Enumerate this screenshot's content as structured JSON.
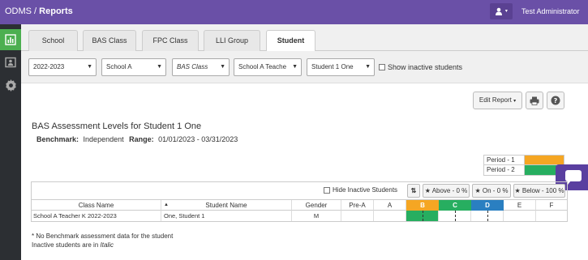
{
  "header": {
    "app_name": "ODMS",
    "separator": " / ",
    "page": "Reports",
    "user_icon": "user-icon",
    "user_name": "Test Administrator"
  },
  "sidebar": {
    "items": [
      {
        "icon": "bar-chart-icon",
        "active": true
      },
      {
        "icon": "id-card-icon",
        "active": false
      },
      {
        "icon": "gear-icon",
        "active": false
      }
    ]
  },
  "tabs": [
    {
      "label": "School",
      "active": false
    },
    {
      "label": "BAS Class",
      "active": false
    },
    {
      "label": "FPC Class",
      "active": false
    },
    {
      "label": "LLI Group",
      "active": false
    },
    {
      "label": "Student",
      "active": true
    }
  ],
  "filters": {
    "year": "2022-2023",
    "school": "School A",
    "class_type": "BAS Class",
    "teacher": "School A Teache",
    "student": "Student 1 One",
    "show_inactive_label": "Show inactive students"
  },
  "actions": {
    "edit_report_label": "Edit Report",
    "print_icon": "print-icon",
    "help_icon": "help-icon"
  },
  "report": {
    "title": "BAS Assessment Levels for Student 1 One",
    "benchmark_label": "Benchmark:",
    "benchmark_value": "Independent",
    "range_label": "Range:",
    "range_value": "01/01/2023 - 03/31/2023"
  },
  "legend": [
    {
      "label": "Period - 1",
      "color": "#f5a623"
    },
    {
      "label": "Period - 2",
      "color": "#27ae60"
    }
  ],
  "table": {
    "hide_inactive_label": "Hide Inactive Students",
    "sort_icon": "sort-icon",
    "above_label": "Above - 0 %",
    "on_label": "On - 0 %",
    "below_label": "Below - 100 %",
    "columns": {
      "class_name": "Class Name",
      "student_name": "Student Name",
      "gender": "Gender",
      "pre_a": "Pre-A",
      "a": "A",
      "b": "B",
      "c": "C",
      "d": "D",
      "e": "E",
      "f": "F"
    },
    "level_colors": {
      "b": "#f5a623",
      "c": "#27ae60",
      "d": "#2a7fc1"
    },
    "rows": [
      {
        "class_name": "School A Teacher K 2022-2023",
        "student_name": "One, Student 1",
        "gender": "M"
      }
    ]
  },
  "notes": {
    "line1": "* No Benchmark assessment data for the student",
    "line2_prefix": "Inactive students are in ",
    "line2_italic": "Italic"
  }
}
